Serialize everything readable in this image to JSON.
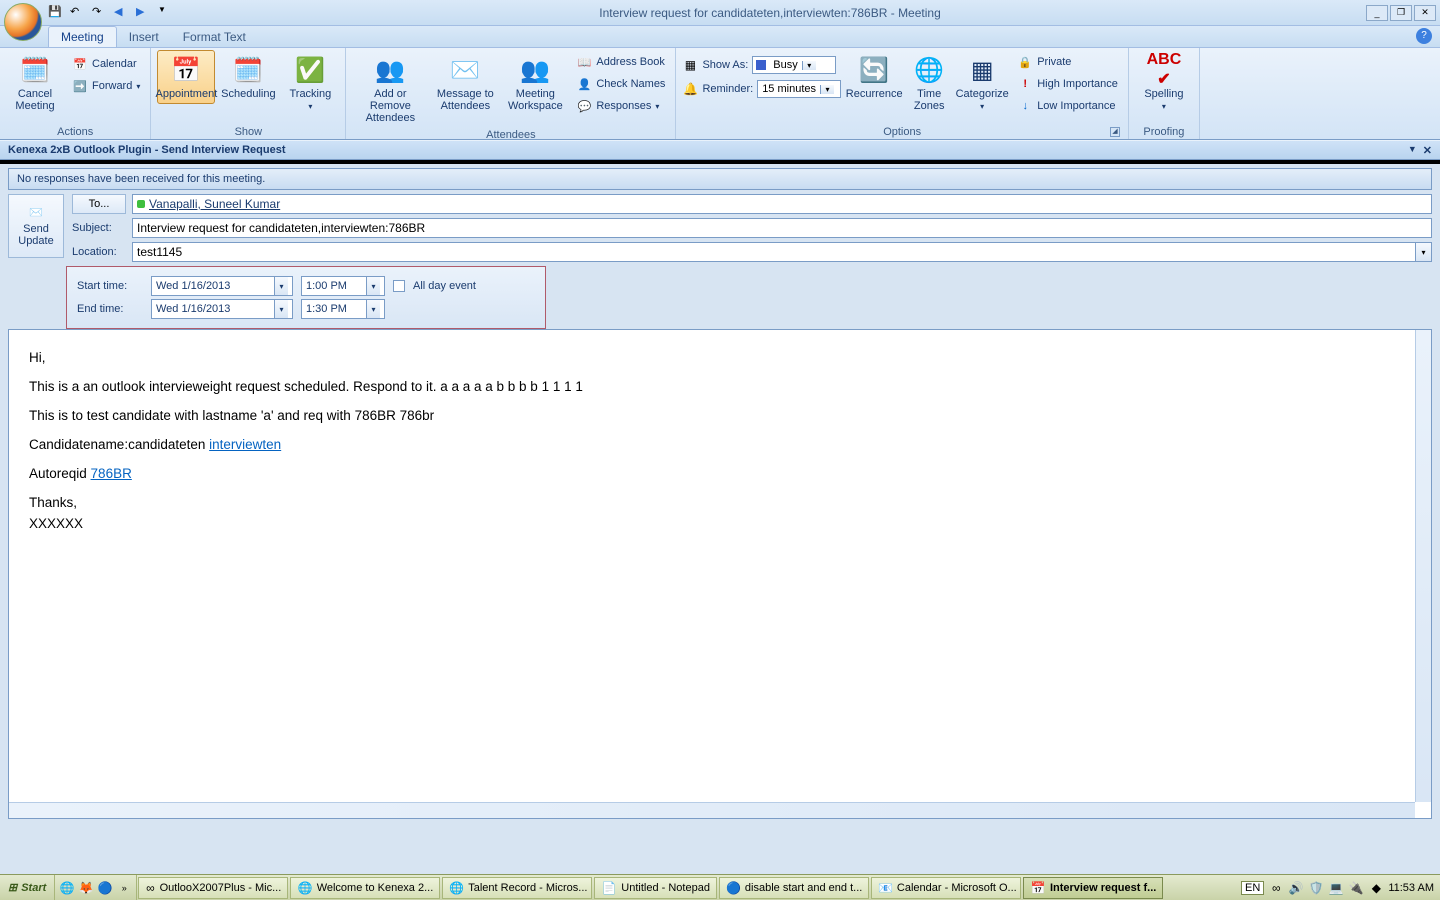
{
  "window": {
    "title": "Interview request for candidateten,interviewten:786BR - Meeting"
  },
  "tabs": {
    "meeting": "Meeting",
    "insert": "Insert",
    "formatText": "Format Text"
  },
  "ribbon": {
    "actions": {
      "cancelMeeting": "Cancel\nMeeting",
      "calendar": "Calendar",
      "forward": "Forward",
      "label": "Actions"
    },
    "show": {
      "appointment": "Appointment",
      "scheduling": "Scheduling",
      "tracking": "Tracking",
      "label": "Show"
    },
    "attendees": {
      "addRemove": "Add or Remove\nAttendees",
      "message": "Message to\nAttendees",
      "workspace": "Meeting\nWorkspace",
      "addressBook": "Address Book",
      "checkNames": "Check Names",
      "responses": "Responses",
      "label": "Attendees"
    },
    "options": {
      "showAsLbl": "Show As:",
      "showAsVal": "Busy",
      "reminderLbl": "Reminder:",
      "reminderVal": "15 minutes",
      "recurrence": "Recurrence",
      "timeZones": "Time\nZones",
      "categorize": "Categorize",
      "private": "Private",
      "highImp": "High Importance",
      "lowImp": "Low Importance",
      "label": "Options"
    },
    "proofing": {
      "spelling": "Spelling",
      "label": "Proofing"
    }
  },
  "pluginBar": "Kenexa 2xB Outlook Plugin - Send Interview Request",
  "infoBar": "No responses have been received for this meeting.",
  "form": {
    "toBtn": "To...",
    "toValue": "Vanapalli, Suneel Kumar",
    "subjectLbl": "Subject:",
    "subjectVal": "Interview request for candidateten,interviewten:786BR",
    "locationLbl": "Location:",
    "locationVal": "test1145",
    "send": "Send\nUpdate",
    "startLbl": "Start time:",
    "startDate": "Wed 1/16/2013",
    "startTime": "1:00 PM",
    "endLbl": "End time:",
    "endDate": "Wed 1/16/2013",
    "endTime": "1:30 PM",
    "allDay": "All day event"
  },
  "body": {
    "l1": "Hi,",
    "l2a": "This is a an outlook intervieweight request scheduled. Respond to it. a a a a a ",
    "l2b": " b b b b  1 1 1 1",
    "l3": "This is to test candidate with lastname 'a' and req with 786BR   786br",
    "l4a": "Candidatename:candidateten ",
    "l4link": "interviewten",
    "l5a": "Autoreqid ",
    "l5link": "786BR",
    "l6": "Thanks,",
    "l7": "XXXXXX"
  },
  "taskbar": {
    "start": "Start",
    "items": [
      "OutlooX2007Plus - Mic...",
      "Welcome to Kenexa 2...",
      "Talent Record - Micros...",
      "Untitled - Notepad",
      "disable start and end t...",
      "Calendar - Microsoft O...",
      "Interview request f..."
    ],
    "lang": "EN",
    "clock": "11:53 AM"
  }
}
